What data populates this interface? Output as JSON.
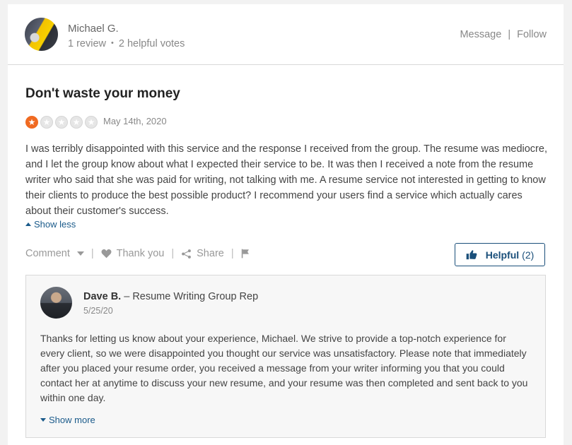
{
  "reviewer": {
    "name": "Michael G.",
    "review_count": "1 review",
    "helpful_votes": "2 helpful votes",
    "message_label": "Message",
    "follow_label": "Follow"
  },
  "review": {
    "title": "Don't waste your money",
    "rating": 1,
    "rating_max": 5,
    "date": "May 14th, 2020",
    "body": "I was terribly disappointed with this service and the response I received from the group. The resume was mediocre, and I let the group know about what I expected their service to be. It was then I received a note from the resume writer who said that she was paid for writing, not talking with me. A resume service not interested in getting to know their clients to produce the best possible product? I recommend your users find a service which actually cares about their customer's success.",
    "show_less": "Show less"
  },
  "actions": {
    "comment": "Comment",
    "thank_you": "Thank you",
    "share": "Share",
    "helpful_label": "Helpful",
    "helpful_count": "(2)"
  },
  "response": {
    "author": "Dave B.",
    "role": "– Resume Writing Group Rep",
    "date": "5/25/20",
    "body": "Thanks for letting us know about your experience, Michael. We strive to provide a top-notch experience for every client, so we were disappointed you thought our service was unsatisfactory. Please note that immediately after you placed your resume order, you received a message from your writer informing you that you could contact her at anytime to discuss your new resume, and your resume was then completed and sent back to you within one day.",
    "show_more": "Show more"
  },
  "colors": {
    "star_filled": "#f06a21",
    "link": "#1a5a8a",
    "helpful_border": "#1a4f7a"
  }
}
